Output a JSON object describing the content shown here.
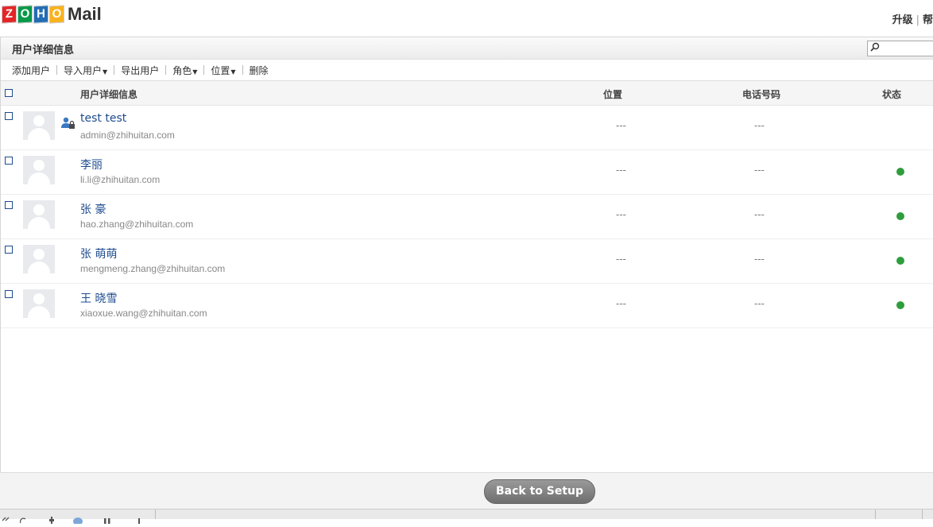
{
  "brand": {
    "zoho_letters": [
      "Z",
      "O",
      "H",
      "O"
    ],
    "product": "Mail"
  },
  "top_links": [
    "升级",
    "帮"
  ],
  "panel": {
    "title": "用户详细信息"
  },
  "toolbar": {
    "add_user": "添加用户",
    "import_users": "导入用户",
    "export_users": "导出用户",
    "role": "角色",
    "location": "位置",
    "delete": "删除"
  },
  "table": {
    "headers": {
      "details": "用户详细信息",
      "location": "位置",
      "phone": "电话号码",
      "status": "状态"
    },
    "rows": [
      {
        "name": "test test",
        "email": "admin@zhihuitan.com",
        "location": "---",
        "phone": "---",
        "status": "",
        "is_admin": true
      },
      {
        "name": "李丽",
        "email": "li.li@zhihuitan.com",
        "location": "---",
        "phone": "---",
        "status": "active"
      },
      {
        "name": "张 豪",
        "email": "hao.zhang@zhihuitan.com",
        "location": "---",
        "phone": "---",
        "status": "active"
      },
      {
        "name": "张 萌萌",
        "email": "mengmeng.zhang@zhihuitan.com",
        "location": "---",
        "phone": "---",
        "status": "active"
      },
      {
        "name": "王 晓雪",
        "email": "xiaoxue.wang@zhihuitan.com",
        "location": "---",
        "phone": "---",
        "status": "active"
      }
    ]
  },
  "footer": {
    "back_button": "Back to Setup"
  },
  "colors": {
    "accent": "#1e4b8f",
    "status_active": "#2e9e3c"
  }
}
